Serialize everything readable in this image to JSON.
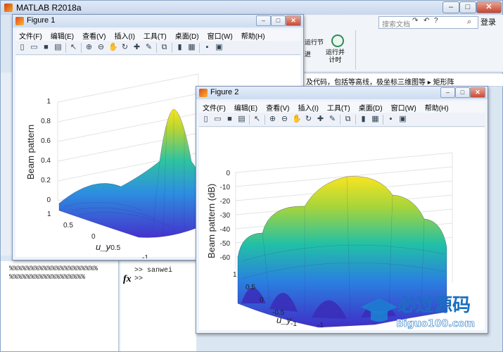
{
  "app": {
    "title": "MATLAB R2018a",
    "search_placeholder": "搜索文档",
    "login": "登录",
    "ribbon_btn1": "运行节",
    "ribbon_btn1b": "进",
    "ribbon_btn2": "运行并\n计时",
    "path": "及代码，包括等高线，极坐标三维图等  ▸  矩形阵",
    "cmd_history": "%%%%%%%%%%%%%%%%%%%%%\n%%%%%%%%%%%%%%%%%%",
    "cmd_line1": ">> sanwei",
    "cmd_line2": ">>",
    "fx": "fx"
  },
  "menu": [
    "文件(F)",
    "编辑(E)",
    "查看(V)",
    "插入(I)",
    "工具(T)",
    "桌面(D)",
    "窗口(W)",
    "帮助(H)"
  ],
  "fig1": {
    "title": "Figure 1",
    "zlabel": "Beam pattern",
    "ylabel": "u_y",
    "zticks": [
      "1",
      "0.8",
      "0.6",
      "0.4",
      "0.2",
      "0"
    ],
    "yticks": [
      "1",
      "0.5",
      "0",
      "-0.5",
      "-1"
    ]
  },
  "fig2": {
    "title": "Figure 2",
    "zlabel": "Beam pattern (dB)",
    "ylabel": "u_y",
    "zticks": [
      "0",
      "-10",
      "-20",
      "-30",
      "-40",
      "-50",
      "-60"
    ],
    "yticks": [
      "1",
      "0.5",
      "0",
      "-0.5",
      "-1"
    ],
    "xticks": [
      "-1"
    ]
  },
  "watermark": {
    "text": "必过源码",
    "url": "Biguo100.com"
  },
  "colors": {
    "accent": "#0a74c4",
    "surface_low": "#4a3fd0",
    "surface_mid": "#27c3a8",
    "surface_high": "#f9e721"
  }
}
